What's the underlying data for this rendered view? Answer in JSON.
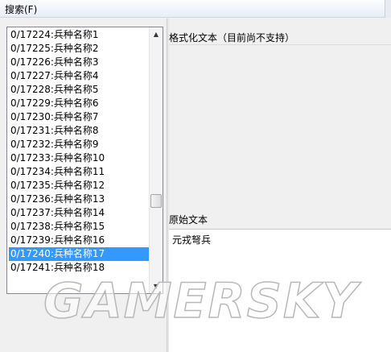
{
  "menu": {
    "search_label": "搜索(F)"
  },
  "list": {
    "items": [
      "0/17224:兵种名称1",
      "0/17225:兵种名称2",
      "0/17226:兵种名称3",
      "0/17227:兵种名称4",
      "0/17228:兵种名称5",
      "0/17229:兵种名称6",
      "0/17230:兵种名称7",
      "0/17231:兵种名称8",
      "0/17232:兵种名称9",
      "0/17233:兵种名称10",
      "0/17234:兵种名称11",
      "0/17235:兵种名称12",
      "0/17236:兵种名称13",
      "0/17237:兵种名称14",
      "0/17238:兵种名称15",
      "0/17239:兵种名称16",
      "0/17240:兵种名称17",
      "0/17241:兵种名称18"
    ],
    "selected_index": 16
  },
  "formatted_text": {
    "label": "格式化文本（目前尚不支持）"
  },
  "raw_text": {
    "label": "原始文本",
    "value": "元戎弩兵"
  },
  "watermark": "GAMERSKY",
  "colors": {
    "selection": "#3399ff"
  }
}
